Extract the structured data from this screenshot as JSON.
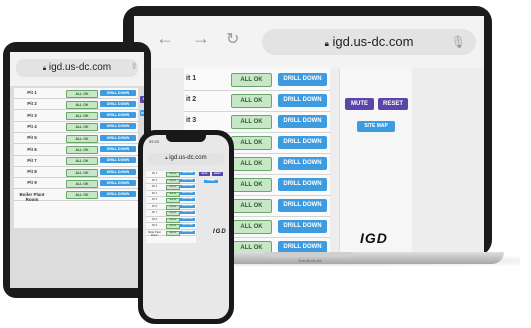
{
  "url": "igd.us-dc.com",
  "points": [
    "Pit 1",
    "Pit 2",
    "Pit 3",
    "Pit 4",
    "Pit 5",
    "Pit 6",
    "Pit 7",
    "Pit 8",
    "Pit 9",
    "Boiler Plant Room"
  ],
  "laptop_rows": [
    "it 1",
    "it 2",
    "it 3",
    "it 4",
    "it 5",
    "it 6",
    "it 7",
    "it 8",
    "it 9"
  ],
  "status_label": "ALL OK",
  "drill_label": "DRILL DOWN",
  "mute_label": "MUTE",
  "reset_label": "RESET",
  "sitemap_label": "SITE MAP",
  "logo_text": "IGD",
  "laptop_model": "NoteBook Air",
  "phone_time": "09:33",
  "colors": {
    "ok_bg": "#c7e7c7",
    "drill_bg": "#3d9be0",
    "mute_bg": "#5a46a8"
  }
}
